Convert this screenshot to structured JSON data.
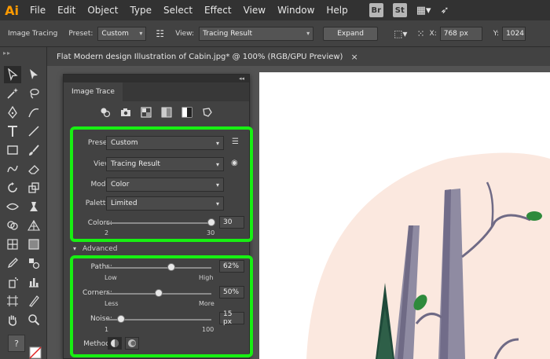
{
  "menubar": {
    "logo": "Ai",
    "items": [
      "File",
      "Edit",
      "Object",
      "Type",
      "Select",
      "Effect",
      "View",
      "Window",
      "Help"
    ],
    "badges": [
      "Br",
      "St"
    ]
  },
  "controlbar": {
    "label": "Image Tracing",
    "preset_label": "Preset:",
    "preset_value": "Custom",
    "view_label": "View:",
    "view_value": "Tracing Result",
    "expand_label": "Expand",
    "x_label": "X:",
    "x_value": "768 px",
    "y_label": "Y:",
    "y_value": "1024"
  },
  "document": {
    "tab_title": "Flat Modern design Illustration of Cabin.jpg* @ 100% (RGB/GPU Preview)",
    "close": "×"
  },
  "panel": {
    "tab": "Image Trace",
    "collapse": "◂◂",
    "preset_label": "Preset:",
    "preset_value": "Custom",
    "view_label": "View:",
    "view_value": "Tracing Result",
    "mode_label": "Mode:",
    "mode_value": "Color",
    "palette_label": "Palette:",
    "palette_value": "Limited",
    "colors_label": "Colors:",
    "colors_value": "30",
    "colors_min": "2",
    "colors_max": "30",
    "colors_level": 1.0,
    "advanced_label": "Advanced",
    "paths_label": "Paths:",
    "paths_value": "62%",
    "paths_min": "Low",
    "paths_max": "High",
    "paths_level": 0.62,
    "corners_label": "Corners:",
    "corners_value": "50%",
    "corners_min": "Less",
    "corners_max": "More",
    "corners_level": 0.5,
    "noise_label": "Noise:",
    "noise_value": "15 px",
    "noise_min": "1",
    "noise_max": "100",
    "noise_level": 0.14,
    "method_label": "Method:"
  },
  "colors": {
    "highlight": "#17f012",
    "ai_orange": "#ff9a00",
    "panel_bg": "#424242",
    "canvas_bg": "#535353",
    "art_blush": "#fbe8df",
    "tree_gray": "#8f8ba2",
    "leaf_green": "#2e8a3c",
    "pine_dark": "#1f4a3a"
  }
}
